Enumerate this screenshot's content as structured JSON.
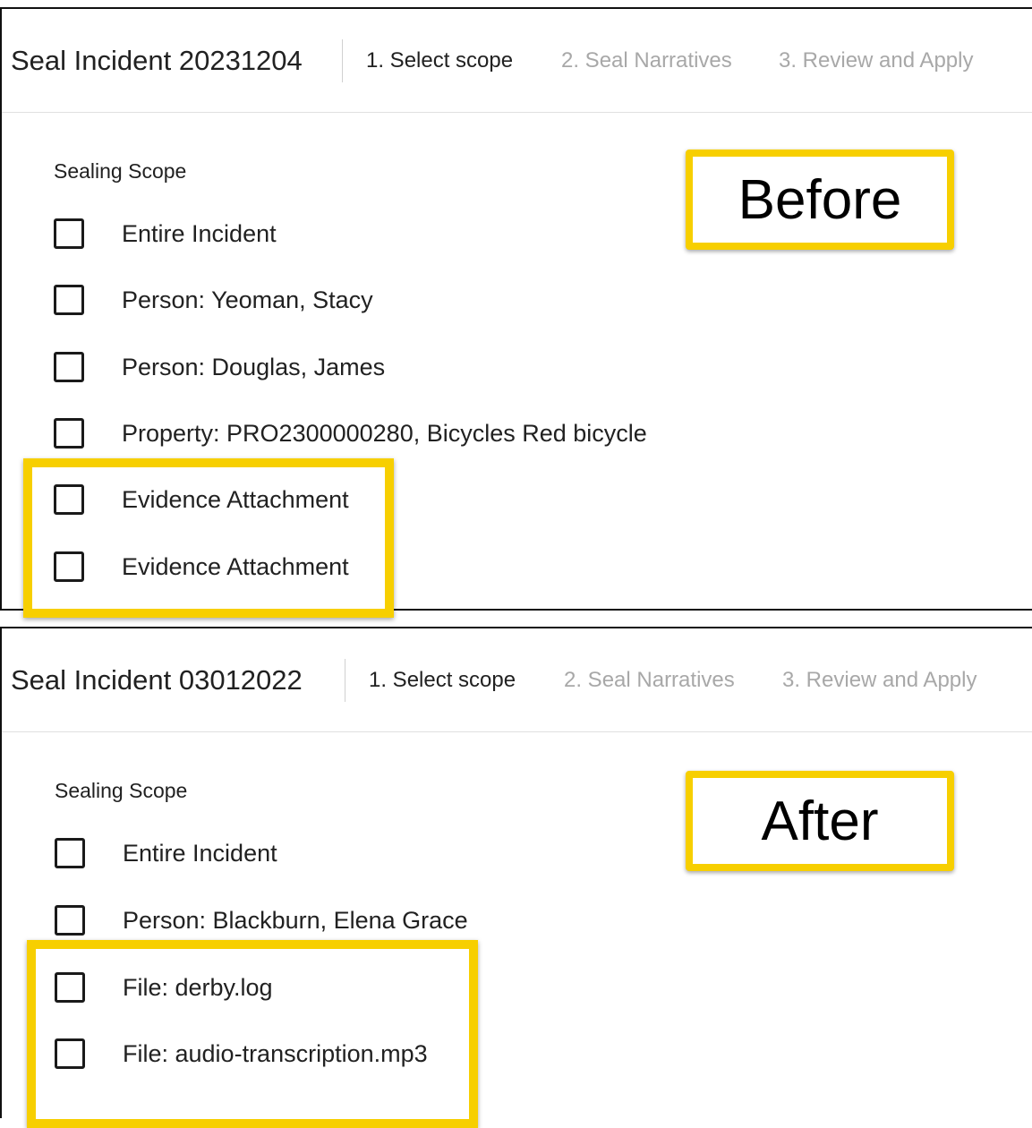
{
  "panels": [
    {
      "incident_title": "Seal Incident 20231204",
      "steps": [
        "1. Select scope",
        "2. Seal Narratives",
        "3. Review and Apply"
      ],
      "section_label": "Sealing Scope",
      "items": [
        "Entire Incident",
        "Person: Yeoman, Stacy",
        "Person: Douglas, James",
        "Property: PRO2300000280, Bicycles Red bicycle",
        "Evidence Attachment",
        "Evidence Attachment"
      ],
      "callout": "Before"
    },
    {
      "incident_title": "Seal Incident 03012022",
      "steps": [
        "1. Select scope",
        "2. Seal Narratives",
        "3. Review and Apply"
      ],
      "section_label": "Sealing Scope",
      "items": [
        "Entire Incident",
        "Person: Blackburn, Elena Grace",
        "File: derby.log",
        "File: audio-transcription.mp3"
      ],
      "callout": "After"
    }
  ],
  "colors": {
    "highlight": "#f7cf00",
    "active_step": "#212121",
    "inactive_step": "#a8a8a8"
  }
}
